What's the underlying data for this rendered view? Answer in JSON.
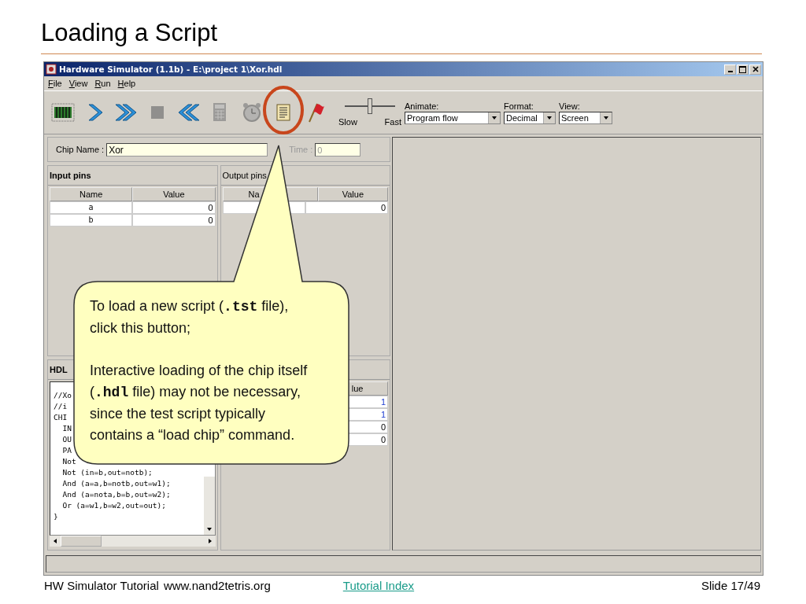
{
  "slide": {
    "title": "Loading a Script"
  },
  "window": {
    "title": "Hardware Simulator (1.1b) - E:\\project 1\\Xor.hdl"
  },
  "menu": [
    "File",
    "View",
    "Run",
    "Help"
  ],
  "toolbar": [
    {
      "kind": "chip",
      "disabled": false
    },
    {
      "kind": "step",
      "disabled": false
    },
    {
      "kind": "run",
      "disabled": false
    },
    {
      "kind": "stop",
      "disabled": true
    },
    {
      "kind": "reset",
      "disabled": false
    },
    {
      "kind": "calculator",
      "disabled": true
    },
    {
      "kind": "clock",
      "disabled": true
    },
    {
      "kind": "script",
      "disabled": false
    },
    {
      "kind": "flag",
      "disabled": false
    }
  ],
  "speed": {
    "level": 0.5,
    "min_label": "Slow",
    "max_label": "Fast"
  },
  "dropdowns": [
    {
      "label": "Animate:",
      "value": "Program flow"
    },
    {
      "label": "Format:",
      "value": "Decimal"
    },
    {
      "label": "View:",
      "value": "Screen"
    }
  ],
  "chip_name": {
    "label": "Chip Name :",
    "value": "Xor"
  },
  "time": {
    "label": "Time :",
    "value": "0",
    "disabled": true
  },
  "input_pins": {
    "title": "Input pins",
    "columns": [
      "Name",
      "Value"
    ],
    "rows": [
      {
        "name": "a",
        "value": "0"
      },
      {
        "name": "b",
        "value": "0"
      }
    ]
  },
  "output_pins": {
    "title": "Output pins",
    "columns": [
      "Na",
      "Value"
    ],
    "rows": [
      {
        "value": "0"
      }
    ]
  },
  "hdl": {
    "title": "HDL",
    "lines": [
      "//Xo",
      "//i",
      "CHI",
      "  IN",
      "  OU",
      "  PA",
      "  Not",
      "  Not (in=b,out=notb);",
      "  And (a=a,b=notb,out=w1);",
      "  And (a=nota,b=b,out=w2);",
      "  Or (a=w1,b=w2,out=out);",
      "}"
    ]
  },
  "internal_pins": {
    "column": "lue",
    "rows": [
      {
        "value": "1",
        "highlighted": true
      },
      {
        "value": "1",
        "highlighted": true
      },
      {
        "value": "0",
        "highlighted": false
      },
      {
        "value": "0",
        "highlighted": false
      }
    ]
  },
  "callout": {
    "paragraphs": [
      "To load a new script (**.tst** file), click this button;",
      "Interactive loading of the chip itself (**.hdl** file) may not be necessary, since the test script typically contains a “load chip” command."
    ]
  },
  "footer": {
    "course": "HW Simulator Tutorial",
    "site": "www.nand2tetris.org",
    "link": "Tutorial Index",
    "slide": "Slide 17/49"
  }
}
